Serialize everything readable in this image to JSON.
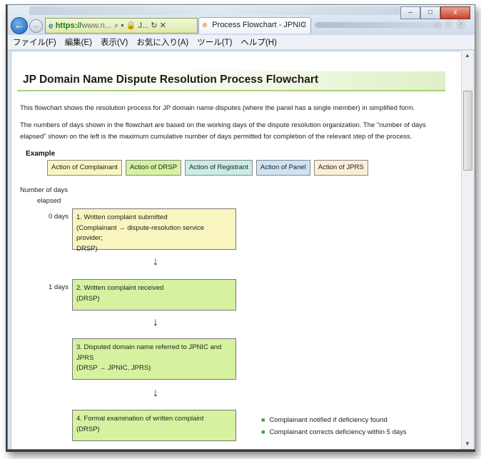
{
  "browser": {
    "address": {
      "https": "https://",
      "rest": "www.n...",
      "tools": "⌕ ▾ 🔒 J... ↻ ✕"
    },
    "tab": {
      "title": "Process Flowchart - JPNIC",
      "close": "×"
    },
    "window_controls": {
      "minimize": "–",
      "maximize": "□",
      "close": "x"
    },
    "right_icons": "⌂☆⚙",
    "menu": [
      "ファイル(F)",
      "編集(E)",
      "表示(V)",
      "お気に入り(A)",
      "ツール(T)",
      "ヘルプ(H)"
    ]
  },
  "page": {
    "title": "JP Domain Name Dispute Resolution Process Flowchart",
    "intro": "This flowchart shows the resolution process for JP domain name disputes (where the panel has a single member) in simplified form.",
    "days_note": "The numbers of days shown in the flowchart are based on the working days of the dispute resolution organization. The \"number of days elapsed\" shown on the left is the maximum cumulative number of days permitted for completion of the relevant step of the process.",
    "example_label": "Example",
    "legend": [
      {
        "label": "Action of Complainant",
        "color": "#f8f5c1"
      },
      {
        "label": "Action of DRSP",
        "color": "#d6f2a0"
      },
      {
        "label": "Action of Registrant",
        "color": "#c9ece6"
      },
      {
        "label": "Action of Panel",
        "color": "#cfe3f5"
      },
      {
        "label": "Action of JPRS",
        "color": "#fbeed6"
      }
    ],
    "days_header_line1": "Number of days",
    "days_header_line2": "elapsed",
    "steps": [
      {
        "day": "0 days",
        "line1": "1. Written complaint submitted",
        "line2": "(Complainant → dispute-resolution service provider;",
        "line3": "DRSP)"
      },
      {
        "day": "1 days",
        "line1": "2. Written complaint received",
        "line2": "(DRSP)"
      },
      {
        "line1": "3. Disputed domain name referred to JPNIC and",
        "line2": "JPRS",
        "line3": "(DRSP → JPNIC, JPRS)"
      },
      {
        "line1": "4. Formal examination of written complaint",
        "line2": "(DRSP)"
      }
    ],
    "arrow": "↓",
    "notes": [
      "Complainant notified if deficiency found",
      "Complainant corrects deficiency within 5 days"
    ]
  }
}
